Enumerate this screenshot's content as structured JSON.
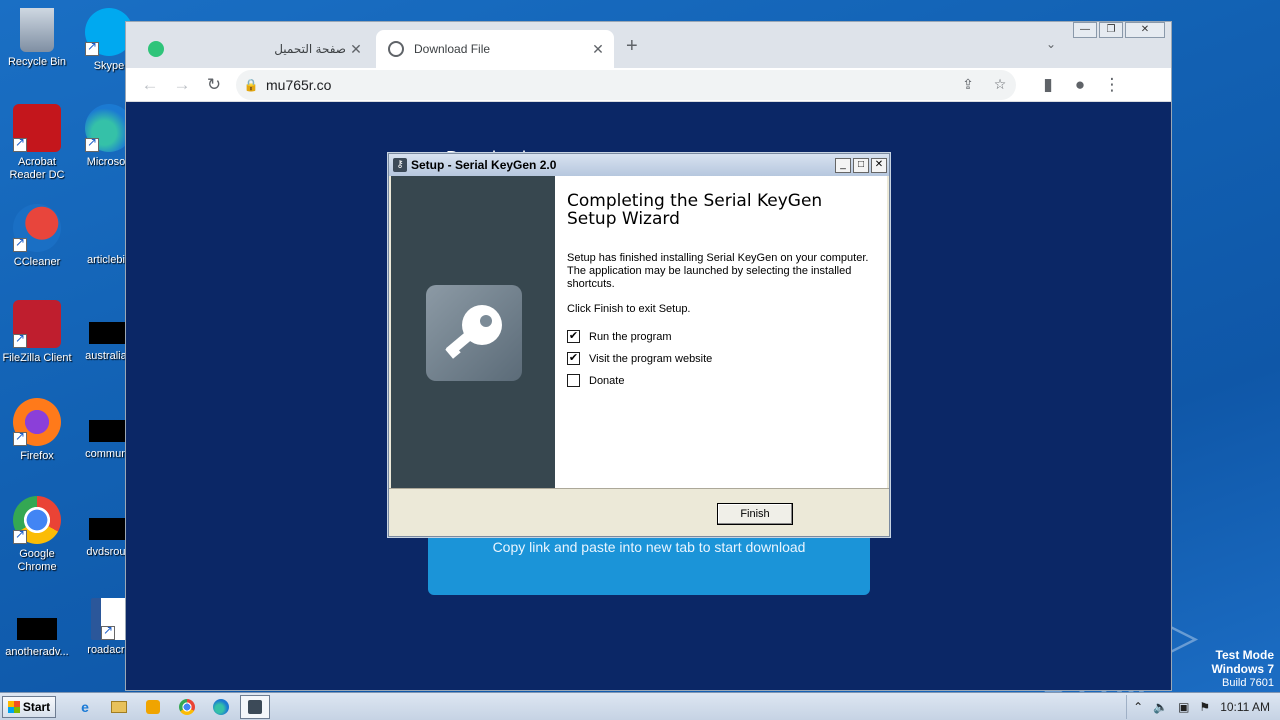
{
  "desktop": {
    "icons_left": [
      "Recycle Bin",
      "Acrobat Reader DC",
      "CCleaner",
      "FileZilla Client",
      "Firefox",
      "Google Chrome",
      "anotheradv..."
    ],
    "icons_right": [
      "Skype",
      "Microsoft",
      "articlebig",
      "australian",
      "communit",
      "dvdsroun",
      "roadacro"
    ]
  },
  "watermark": "ANY ▷ RUN",
  "test_mode": {
    "line1": "Test Mode",
    "line2": "Windows 7",
    "line3": "Build 7601"
  },
  "browser": {
    "tabs": [
      {
        "title": "صفحة التحميل",
        "close": "✕",
        "active": false
      },
      {
        "title": "Download File",
        "close": "✕",
        "active": true
      }
    ],
    "new_tab": "+",
    "tab_search": "⌄",
    "window_buttons": {
      "minimize": "—",
      "restore": "❐",
      "close": "✕"
    },
    "nav": {
      "back": "←",
      "forward": "→",
      "reload": "↻"
    },
    "address": {
      "lock": "🔒",
      "url": "mu765r.co"
    },
    "toolbar_icons": {
      "share": "⇪",
      "star": "☆",
      "sidepanel": "▮",
      "profile": "●",
      "menu": "⋮"
    },
    "page": {
      "title": "Download",
      "download_text": "Copy link and paste into new tab to start download"
    }
  },
  "setup": {
    "window_title": "Setup - Serial KeyGen 2.0",
    "buttons": {
      "minimize": "_",
      "maximize": "□",
      "close": "✕"
    },
    "heading": "Completing the Serial KeyGen Setup Wizard",
    "para1": "Setup has finished installing Serial KeyGen on your computer. The application may be launched by selecting the installed shortcuts.",
    "para2": "Click Finish to exit Setup.",
    "checkboxes": [
      {
        "label": "Run the program",
        "checked": true
      },
      {
        "label": "Visit the program website",
        "checked": true
      },
      {
        "label": "Donate",
        "checked": false
      }
    ],
    "check_mark": "✔",
    "finish_label": "Finish"
  },
  "taskbar": {
    "start_label": "Start",
    "items": [
      "ie-icon",
      "explorer-icon",
      "media-player-icon",
      "chrome-icon",
      "edge-icon",
      "setup-icon"
    ],
    "tray": {
      "arrow": "⌃",
      "volume": "🔈",
      "network": "▣",
      "flag": "⚑"
    },
    "clock": "10:11 AM"
  }
}
